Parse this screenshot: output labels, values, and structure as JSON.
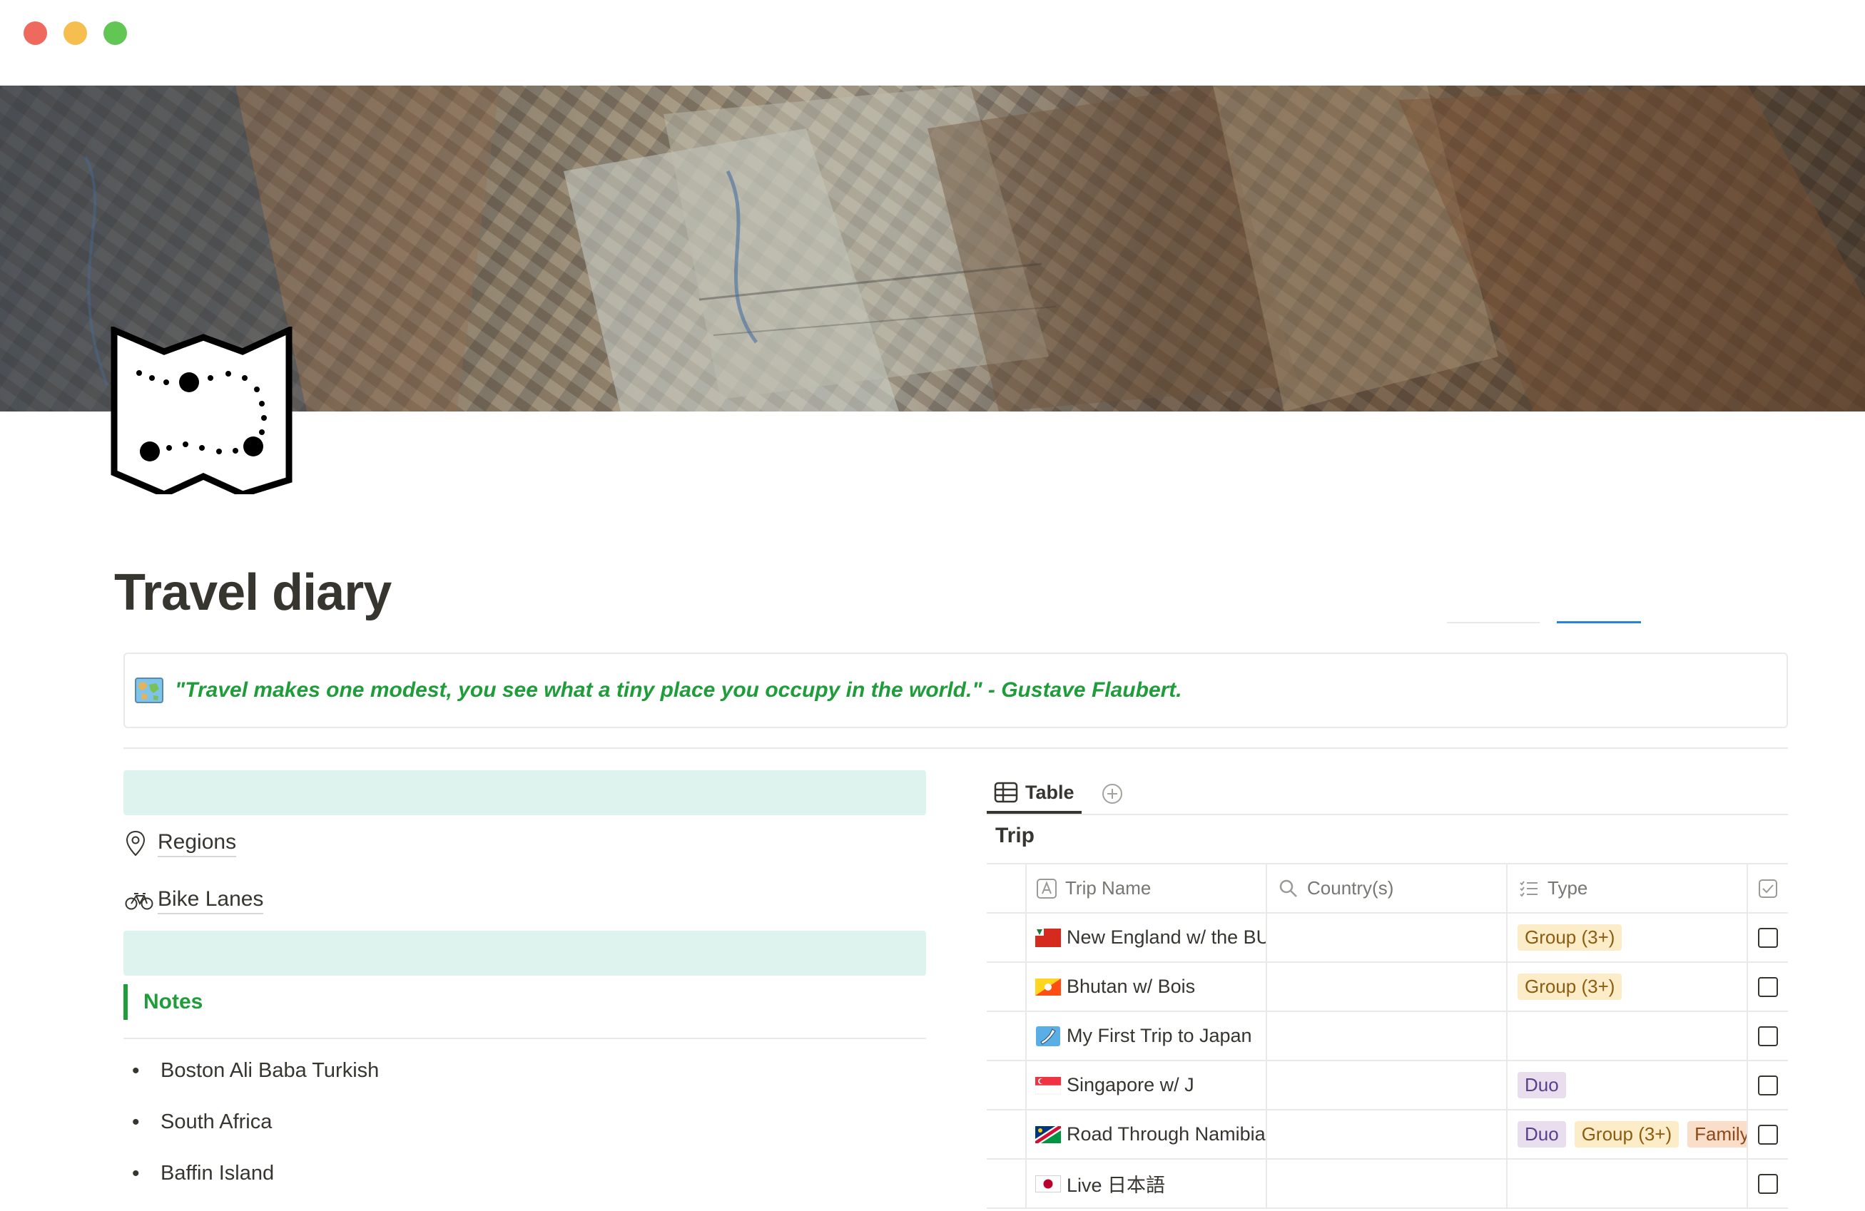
{
  "page": {
    "title": "Travel diary",
    "quote": "\"Travel makes one modest, you see what a tiny place you occupy in the world.\" - Gustave Flaubert.",
    "cover_icon": "map-icon",
    "quote_icon": "world-map-emoji-icon"
  },
  "links": {
    "regions": "Regions",
    "bike_lanes": "Bike Lanes"
  },
  "notes": {
    "heading": "Notes",
    "items": [
      "Boston Ali Baba Turkish",
      "South Africa",
      "Baffin Island"
    ]
  },
  "database": {
    "tab_label": "Table",
    "title": "Trip",
    "columns": {
      "name": "Trip Name",
      "country": "Country(s)",
      "type": "Type"
    },
    "rows": [
      {
        "name": "New England w/ the BU",
        "flag": "flag-red-icon",
        "tags": [
          "Group (3+)"
        ]
      },
      {
        "name": "Bhutan w/ Bois",
        "flag": "flag-bhutan-icon",
        "tags": [
          "Group (3+)"
        ]
      },
      {
        "name": "My First Trip to Japan",
        "flag": "map-japan-icon",
        "tags": []
      },
      {
        "name": "Singapore w/ J",
        "flag": "flag-singapore-icon",
        "tags": [
          "Duo"
        ]
      },
      {
        "name": "Road Through Namibia",
        "flag": "flag-namibia-icon",
        "tags": [
          "Duo",
          "Group (3+)",
          "Family"
        ]
      },
      {
        "name": "Live 日本語",
        "flag": "flag-japan-icon",
        "tags": []
      }
    ]
  },
  "colors": {
    "accent_green": "#1f9d3a",
    "teal_bar": "#dff3ee",
    "tag_group": "#fdecc8",
    "tag_duo": "#e8deee",
    "tag_family": "#fadec9"
  }
}
